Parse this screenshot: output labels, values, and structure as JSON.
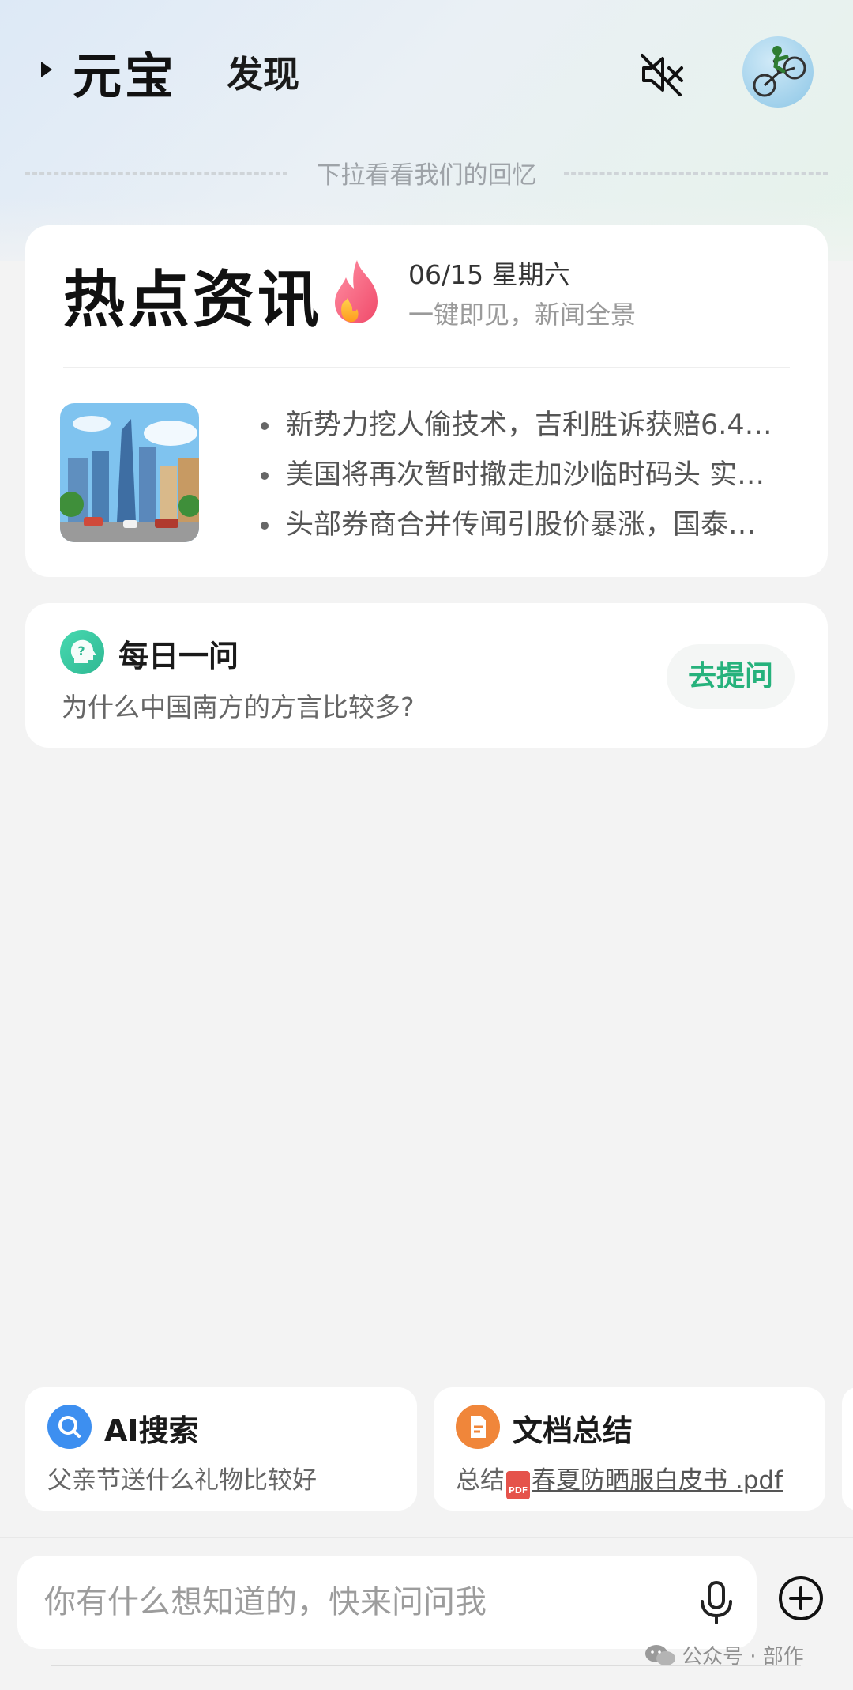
{
  "header": {
    "app_title": "元宝",
    "tab_label": "发现"
  },
  "pull_hint": "下拉看看我们的回忆",
  "news": {
    "title": "热点资讯",
    "date": "06/15 星期六",
    "tagline": "一键即见，新闻全景",
    "headlines": [
      "新势力挖人偷技术，吉利胜诉获赔6.4…",
      "美国将再次暂时撤走加沙临时码头 实…",
      "头部券商合并传闻引股价暴涨，国泰…"
    ]
  },
  "daily": {
    "title": "每日一问",
    "question": "为什么中国南方的方言比较多?",
    "button": "去提问"
  },
  "shortcuts": [
    {
      "title": "AI搜索",
      "subtitle": "父亲节送什么礼物比较好",
      "icon": "search-icon",
      "color": "#3d8ff0"
    },
    {
      "title": "文档总结",
      "prefix": "总结",
      "file": "春夏防晒服白皮书 .pdf",
      "icon": "document-icon",
      "color": "#f0863a"
    }
  ],
  "input": {
    "placeholder": "你有什么想知道的，快来问问我"
  },
  "watermark": "公众号 · 部作",
  "colors": {
    "accent_green": "#26b27c",
    "pdf_red": "#e5534b"
  }
}
